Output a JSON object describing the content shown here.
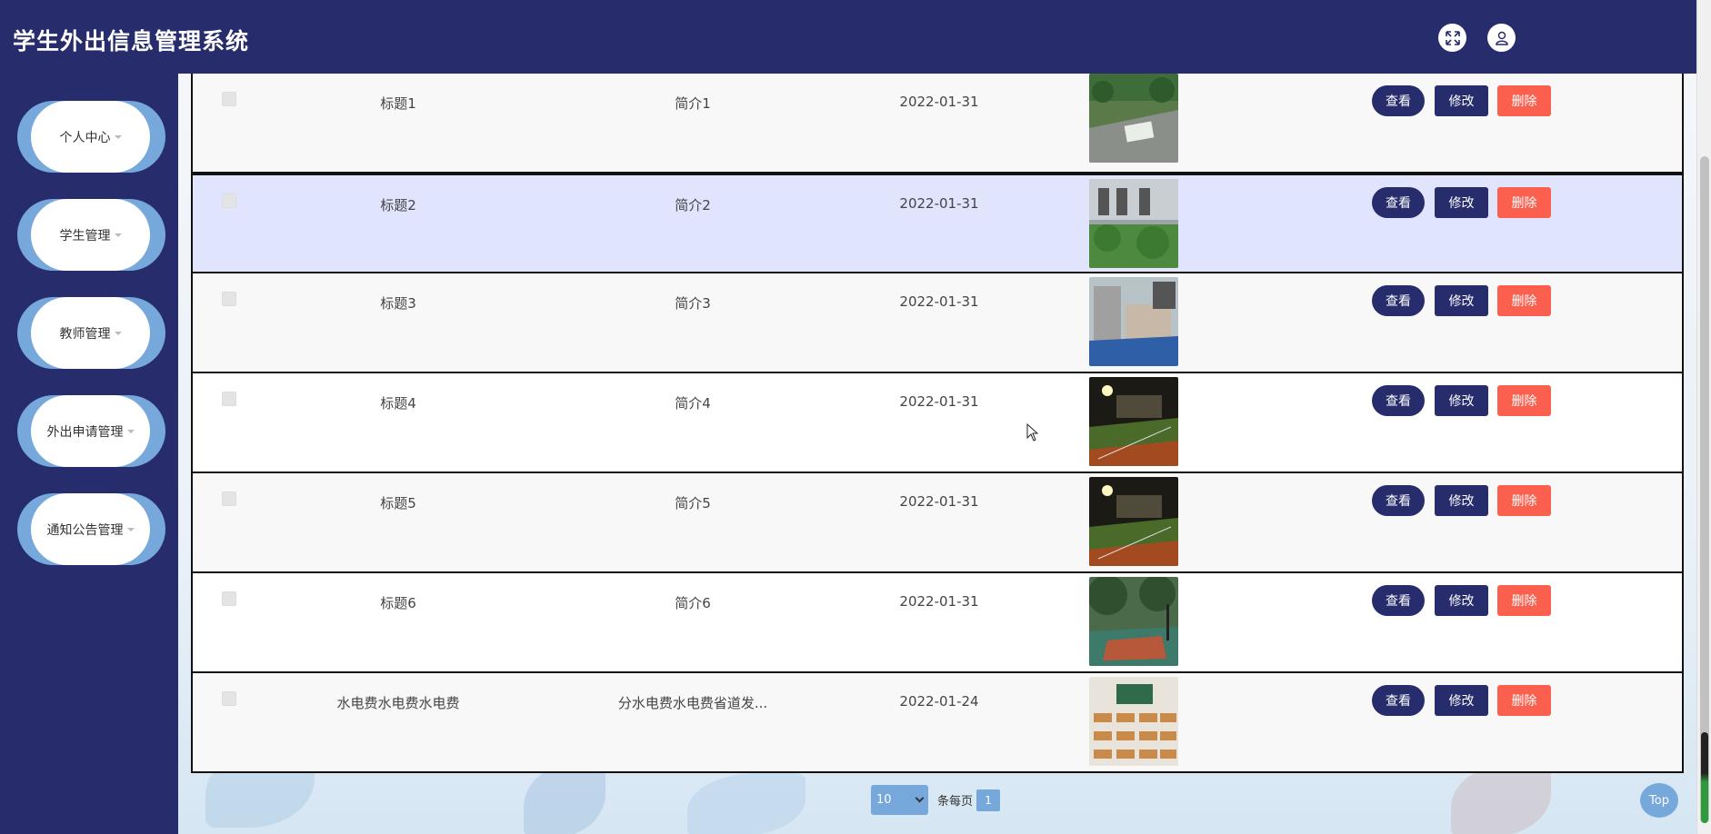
{
  "app": {
    "title": "学生外出信息管理系统"
  },
  "header_icons": [
    {
      "name": "fullscreen-icon"
    },
    {
      "name": "user-icon"
    }
  ],
  "sidebar": {
    "items": [
      {
        "label": "个人中心"
      },
      {
        "label": "学生管理"
      },
      {
        "label": "教师管理"
      },
      {
        "label": "外出申请管理"
      },
      {
        "label": "通知公告管理"
      }
    ]
  },
  "table": {
    "actions": {
      "view": "查看",
      "edit": "修改",
      "delete": "删除"
    },
    "rows": [
      {
        "title": "标题1",
        "intro": "简介1",
        "date": "2022-01-31",
        "image": "campus-garden"
      },
      {
        "title": "标题2",
        "intro": "简介2",
        "date": "2022-01-31",
        "image": "campus-building-shrubs",
        "highlighted": true
      },
      {
        "title": "标题3",
        "intro": "简介3",
        "date": "2022-01-31",
        "image": "campus-track-building"
      },
      {
        "title": "标题4",
        "intro": "简介4",
        "date": "2022-01-31",
        "image": "night-sports-field"
      },
      {
        "title": "标题5",
        "intro": "简介5",
        "date": "2022-01-31",
        "image": "night-sports-field"
      },
      {
        "title": "标题6",
        "intro": "简介6",
        "date": "2022-01-31",
        "image": "basketball-court"
      },
      {
        "title": "水电费水电费水电费",
        "intro": "分水电费水电费省道发...",
        "date": "2022-01-24",
        "image": "classroom"
      }
    ]
  },
  "pagination": {
    "page_size": "10",
    "per_page_label": "条每页",
    "current_page": "1"
  },
  "back_to_top": {
    "label": "Top"
  },
  "colors": {
    "header_bg": "#262c6c",
    "accent": "#76a8dc",
    "delete": "#fb5f4e",
    "highlight_row": "#e0e4fc"
  }
}
